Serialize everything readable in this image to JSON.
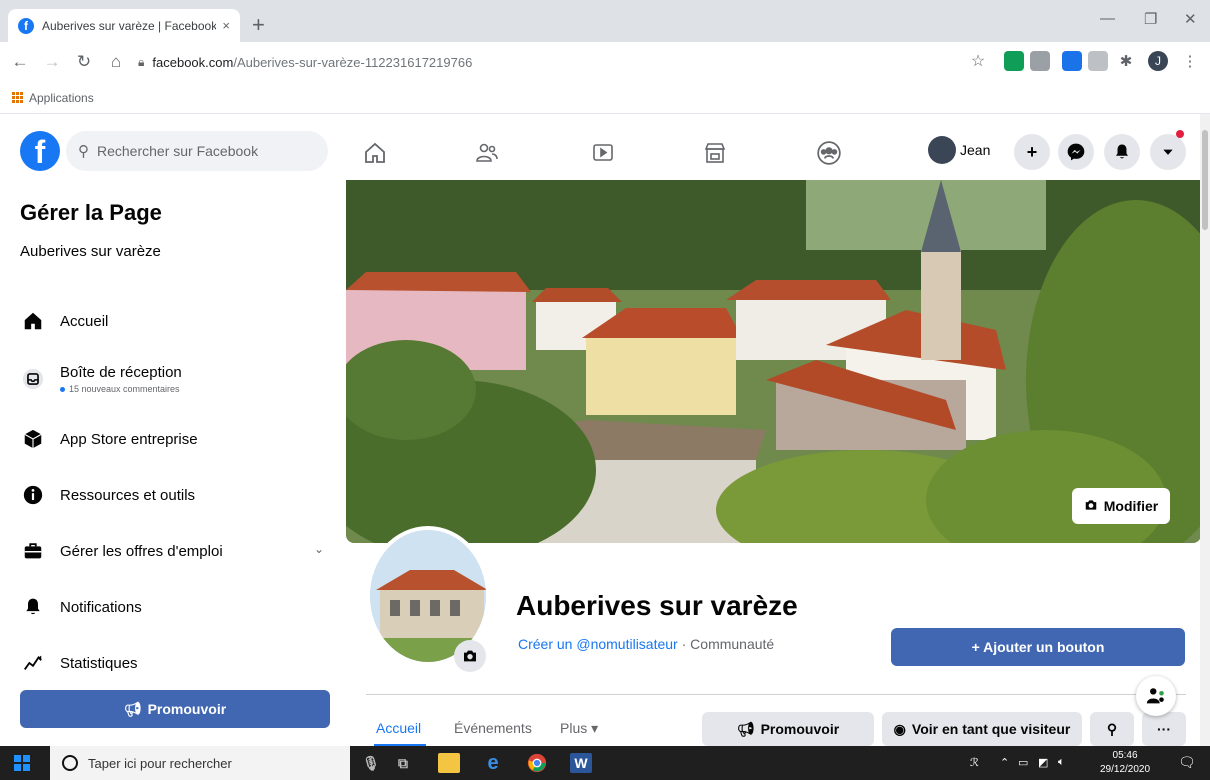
{
  "browser": {
    "tab_title": "Auberives sur varèze | Facebook",
    "tab_close": "×",
    "new_tab": "+",
    "url_domain": "facebook.com",
    "url_path": "/Auberives-sur-varèze-112231617219766",
    "bookmark_apps": "Applications",
    "profile_initial": "J"
  },
  "fb": {
    "search_placeholder": "Rechercher sur Facebook",
    "user_name": "Jean",
    "create_label": "+"
  },
  "sidebar": {
    "title": "Gérer la Page",
    "page_name": "Auberives sur varèze",
    "items": [
      {
        "label": "Accueil",
        "icon": "home-icon"
      },
      {
        "label": "Boîte de réception",
        "icon": "inbox-icon",
        "sub": "15 nouveaux commentaires"
      },
      {
        "label": "App Store entreprise",
        "icon": "store-icon"
      },
      {
        "label": "Ressources et outils",
        "icon": "info-icon"
      },
      {
        "label": "Gérer les offres d'emploi",
        "icon": "briefcase-icon"
      },
      {
        "label": "Notifications",
        "icon": "bell-icon"
      },
      {
        "label": "Statistiques",
        "icon": "chart-icon"
      }
    ],
    "promote_label": "Promouvoir"
  },
  "page": {
    "modify_label": "Modifier",
    "name": "Auberives sur varèze",
    "username_link": "Créer un @nomutilisateur",
    "category": " · Communauté",
    "add_button_label": "+ Ajouter un bouton",
    "tabs": [
      "Accueil",
      "Événements",
      "Plus ▾"
    ],
    "promote_label": "Promouvoir",
    "view_as_label": "Voir en tant que visiteur",
    "more_label": "···"
  },
  "taskbar": {
    "search_placeholder": "Taper ici pour rechercher",
    "time": "05:46",
    "date": "29/12/2020"
  },
  "colors": {
    "fb_blue": "#1877f2",
    "button_blue": "#4267b2",
    "grey_btn": "#e4e6eb"
  }
}
